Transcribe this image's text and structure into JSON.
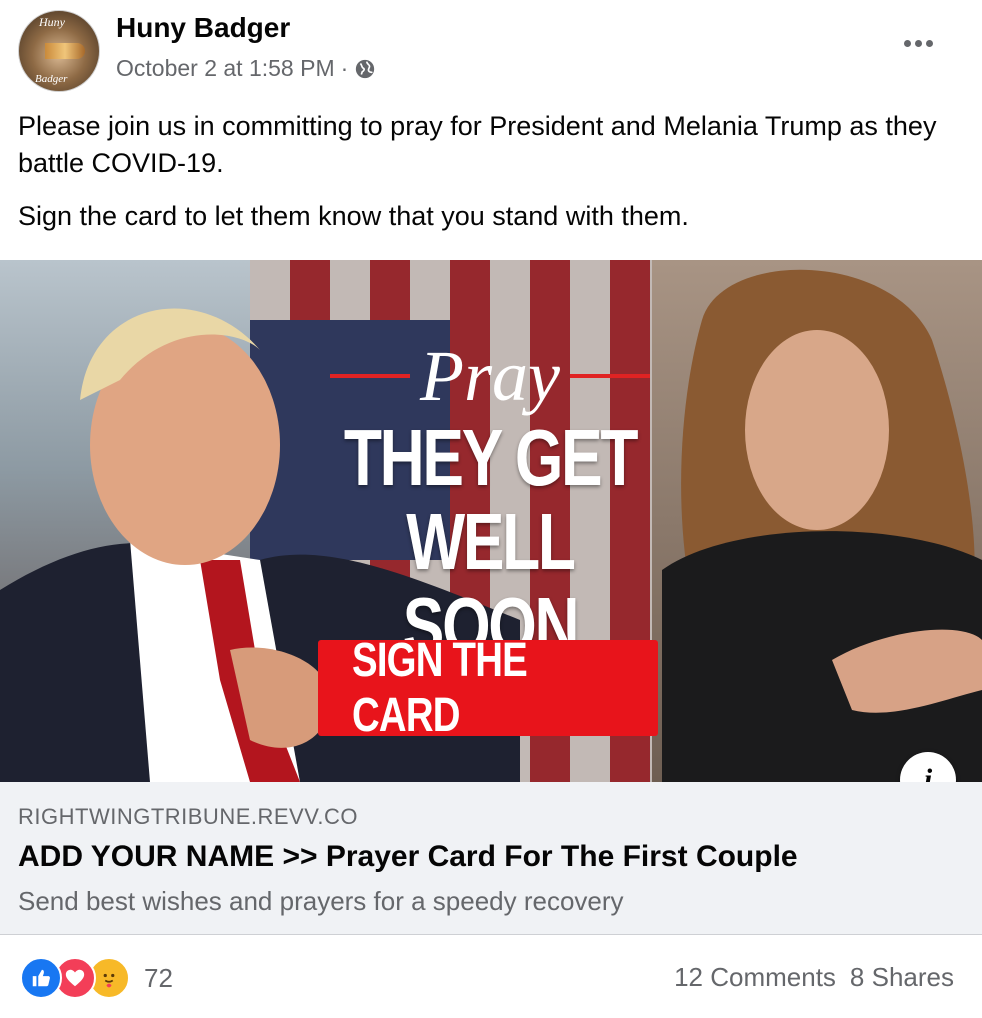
{
  "post": {
    "avatar_text_top": "Huny",
    "avatar_text_bottom": "Badger",
    "page_name": "Huny Badger",
    "timestamp": "October 2 at 1:58 PM",
    "separator": "·",
    "privacy_icon": "globe-icon",
    "more_icon": "ellipsis-icon",
    "text": [
      "Please join us in committing to pray for President and Melania Trump as they battle COVID-19.",
      "Sign the card to let them know that you stand with them."
    ]
  },
  "ad_image": {
    "pray_word": "Pray",
    "headline_line1": "THEY GET",
    "headline_line2": "WELL SOON",
    "button_label": "SIGN THE CARD",
    "info_label": "i"
  },
  "link_preview": {
    "domain": "RIGHTWINGTRIBUNE.REVV.CO",
    "title": "ADD YOUR NAME >> Prayer Card For The First Couple",
    "description": "Send best wishes and prayers for a speedy recovery"
  },
  "engagement": {
    "reaction_icons": [
      "like-icon",
      "love-icon",
      "care-icon"
    ],
    "reaction_count": "72",
    "comments": "12 Comments",
    "shares": "8 Shares"
  },
  "colors": {
    "brand_blue": "#1877f2",
    "love_red": "#f33e58",
    "care_yellow": "#f7b928",
    "cta_red": "#e8141b",
    "secondary_text": "#65676b",
    "link_bg": "#f0f2f5"
  }
}
